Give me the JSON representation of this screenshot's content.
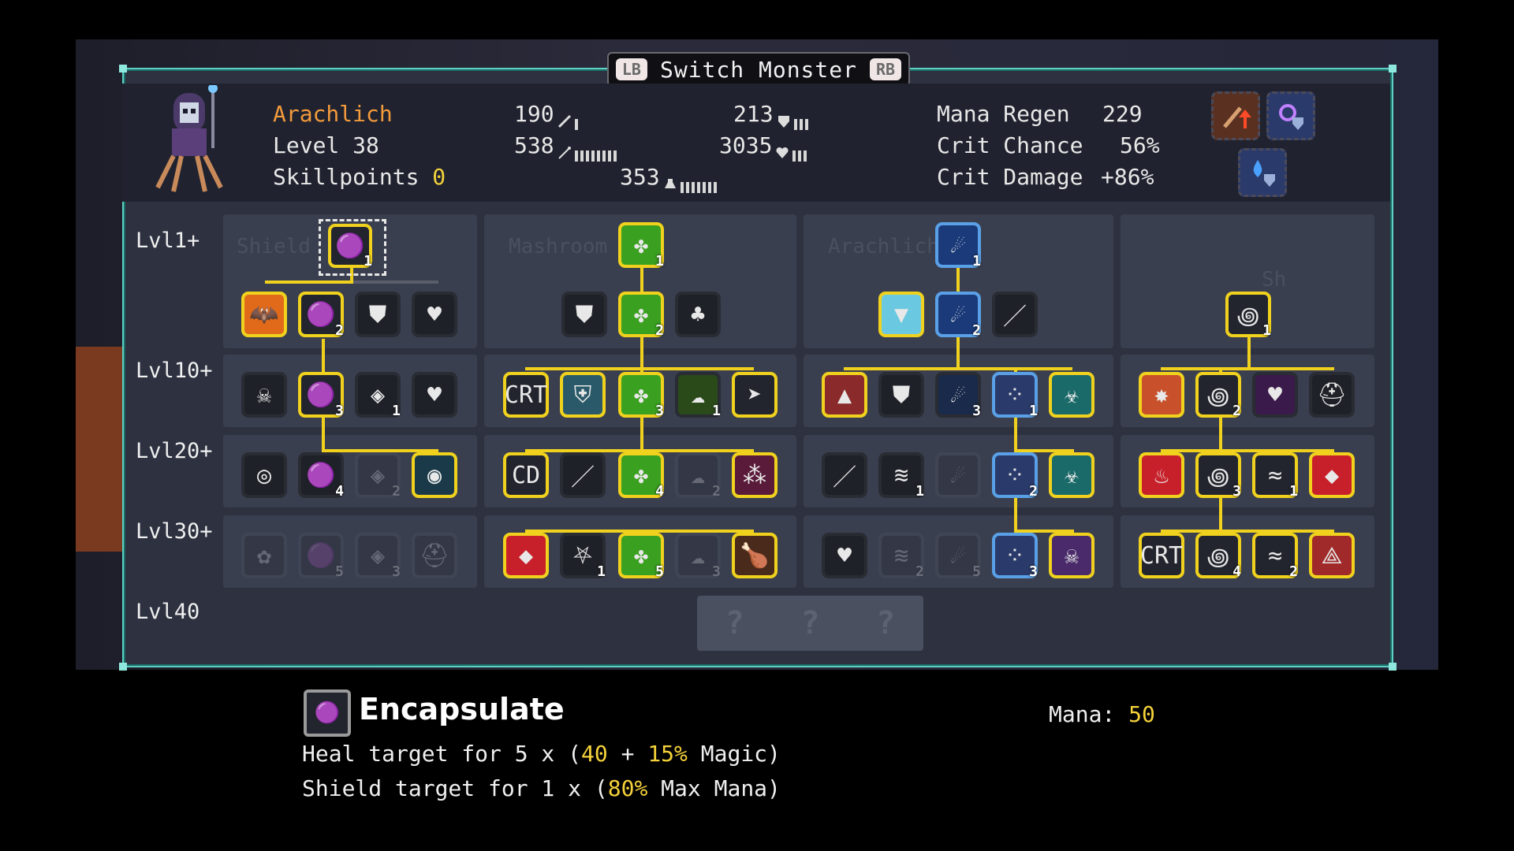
{
  "title": {
    "left_button": "LB",
    "text": "Switch Monster",
    "right_button": "RB"
  },
  "monster": {
    "name": "Arachlich",
    "level_label": "Level 38",
    "skillpoints_label": "Skillpoints",
    "skillpoints_value": "0"
  },
  "stats": {
    "attack": "190",
    "attack_bars": 1,
    "defense": "213",
    "defense_bars": 3,
    "magic": "538",
    "magic_bars": 8,
    "health": "3035",
    "health_bars": 3,
    "mana": "353",
    "mana_bars": 7
  },
  "secondary": [
    {
      "label": "Mana Regen",
      "value": "229"
    },
    {
      "label": "Crit Chance",
      "value": "56%"
    },
    {
      "label": "Crit Damage",
      "value": "+86%"
    }
  ],
  "header_icons": [
    "attack-up-icon",
    "magic-shield-icon",
    "water-shield-icon"
  ],
  "tree": {
    "levels": [
      "Lvl1+",
      "Lvl10+",
      "Lvl20+",
      "Lvl30+",
      "Lvl40"
    ],
    "columns": [
      "Shield",
      "Mashroom",
      "Arachlich",
      "Sh"
    ],
    "unknown": [
      "?",
      "?",
      "?"
    ]
  },
  "skill_numbers": {
    "c1_top": "1",
    "c1_r1b": "2",
    "c1_r2b": "3",
    "c1_r2c": "1",
    "c1_r3b": "4",
    "c1_r3c": "2",
    "c1_r4b": "5",
    "c1_r4c": "3",
    "c2_top": "1",
    "c2_r1b": "2",
    "c2_r2c": "3",
    "c2_r2d": "1",
    "c2_r3c": "4",
    "c2_r3d": "2",
    "c2_r4b": "1",
    "c2_r4c": "5",
    "c2_r4d": "3",
    "c3_top": "1",
    "c3_r1b": "2",
    "c3_r2c": "3",
    "c3_r2d": "1",
    "c3_r3b": "1",
    "c3_r3d": "2",
    "c3_r4b": "2",
    "c3_r4c": "5",
    "c3_r4d": "3",
    "c4_top": "1",
    "c4_r2b": "2",
    "c4_r3b": "3",
    "c4_r3c": "1",
    "c4_r4b": "4",
    "c4_r4c": "2"
  },
  "selected_skill": {
    "name": "Encapsulate",
    "mana_label": "Mana:",
    "mana_value": "50",
    "line1": {
      "pre": "Heal target for 5 x (",
      "v1": "40",
      "mid": " + ",
      "v2": "15%",
      "post": " Magic)"
    },
    "line2": {
      "pre": "Shield target for 1 x (",
      "v1": "80%",
      "post": " Max Mana)"
    }
  },
  "colors": {
    "accent": "#f0d21e",
    "name": "#f39a3c",
    "frame": "#5fd0c6"
  }
}
